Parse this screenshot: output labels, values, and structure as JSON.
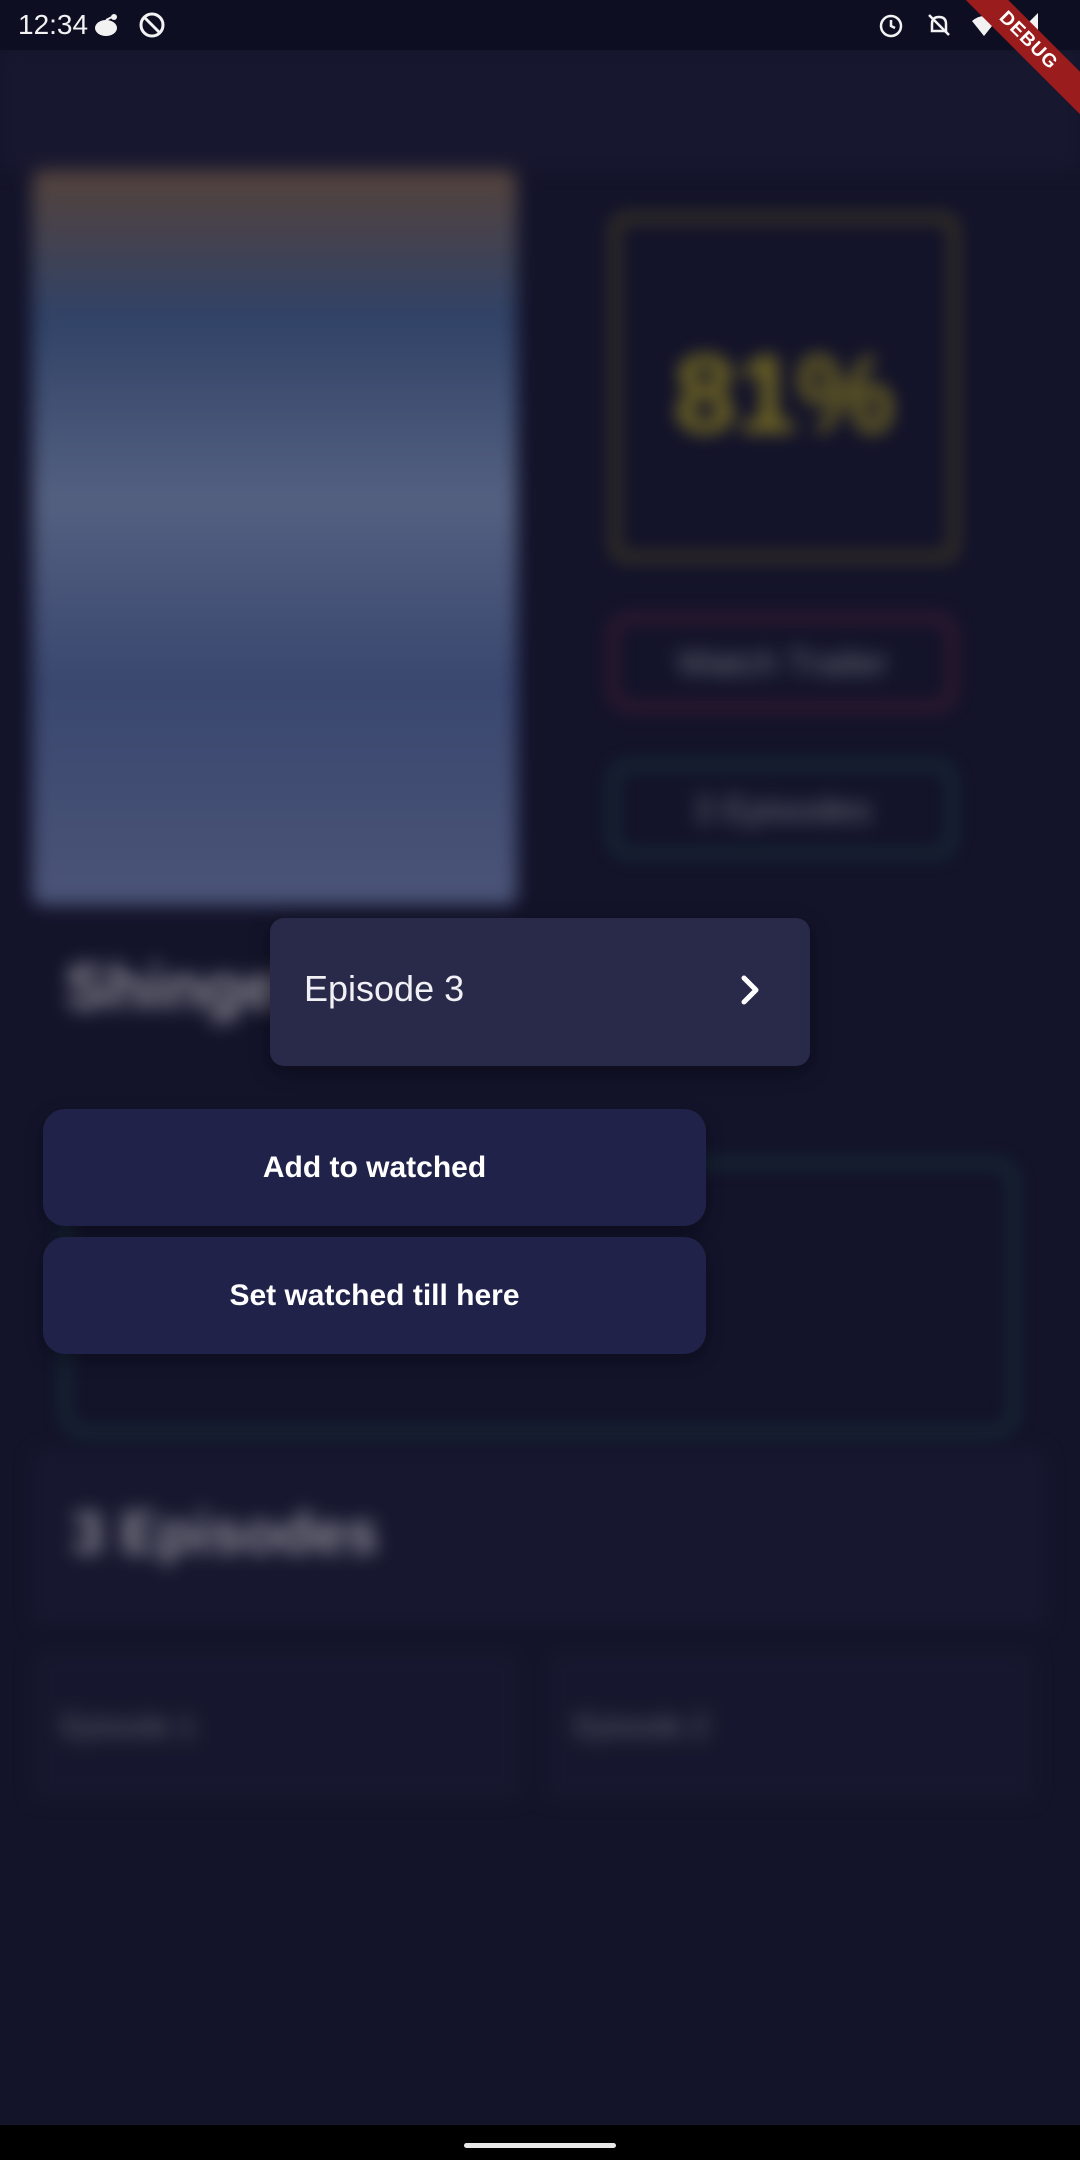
{
  "status_bar": {
    "time": "12:34",
    "debug_label": "DEBUG"
  },
  "background": {
    "score": "81%",
    "watch_trailer_label": "Watch Trailer",
    "episodes_button_label": "3 Episodes",
    "title": "Shingeki",
    "episodes_section_title": "3 Episodes",
    "episode_1": "Episode 1",
    "episode_2": "Episode 2"
  },
  "popup": {
    "episode_title": "Episode 3",
    "add_to_watched_label": "Add to watched",
    "set_watched_till_here_label": "Set watched till here"
  },
  "colors": {
    "page_bg": "#13132a",
    "card_bg": "#29294a",
    "button_bg": "#20224a",
    "score_yellow": "#c8b41e",
    "debug_red": "#9b1c1c"
  }
}
